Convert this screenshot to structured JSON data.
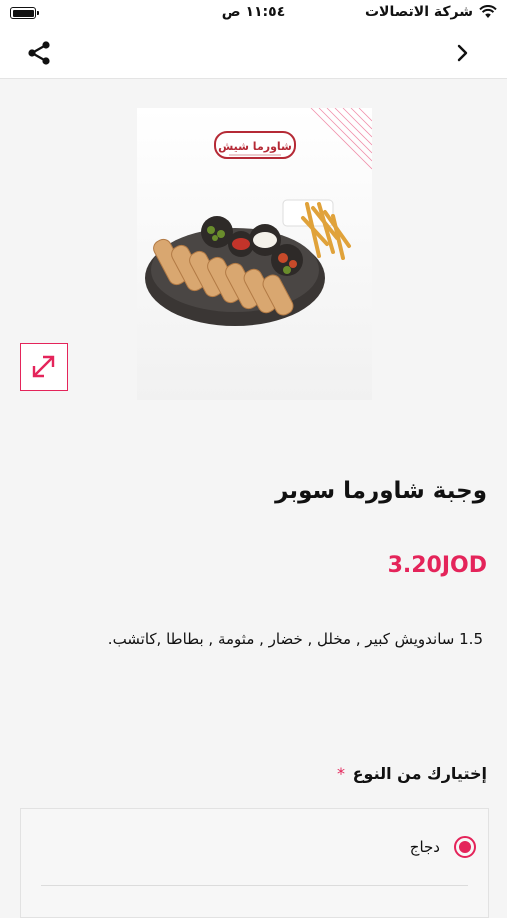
{
  "status_bar": {
    "carrier": "شركة الاتصالات",
    "time": "١١:٥٤ ص"
  },
  "nav": {
    "share_icon": "share-icon",
    "back_icon": "chevron-right-icon"
  },
  "product": {
    "brand_logo_text": "شاورما شيش",
    "title": "وجبة شاورما سوبر",
    "price": "3.20JOD",
    "description": "1.5 ساندويش كبير , مخلل , خضار , مثومة , بطاطا ,كاتشب."
  },
  "options": {
    "label": "إختيارك من النوع",
    "required_marker": "*",
    "items": [
      {
        "label": "دجاج",
        "selected": true
      }
    ]
  },
  "colors": {
    "accent": "#e4245a"
  }
}
